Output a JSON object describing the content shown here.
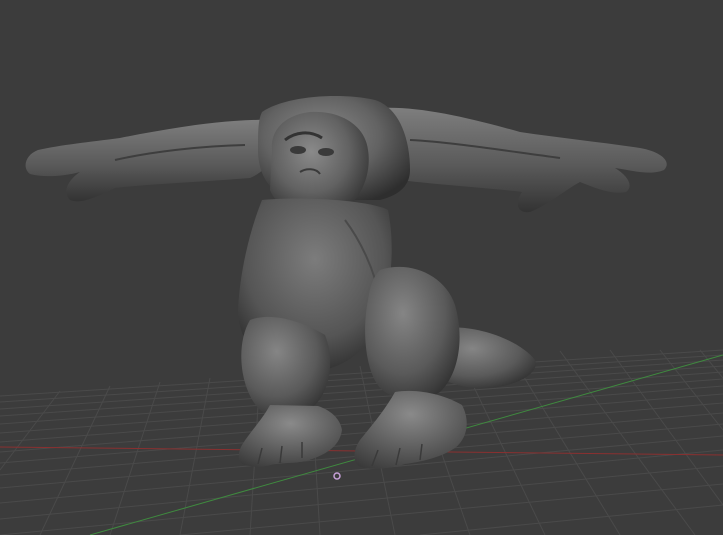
{
  "viewport": {
    "background_color": "#3c3c3c",
    "grid_line_color": "#4a4a4a",
    "x_axis_color": "#8a3030",
    "y_axis_color": "#3f8a3f",
    "model_color": "#5e5e5e",
    "origin_marker_color": "#c7a0d8"
  },
  "scene": {
    "object": "sculpted-creature",
    "pose": "t-pose"
  }
}
